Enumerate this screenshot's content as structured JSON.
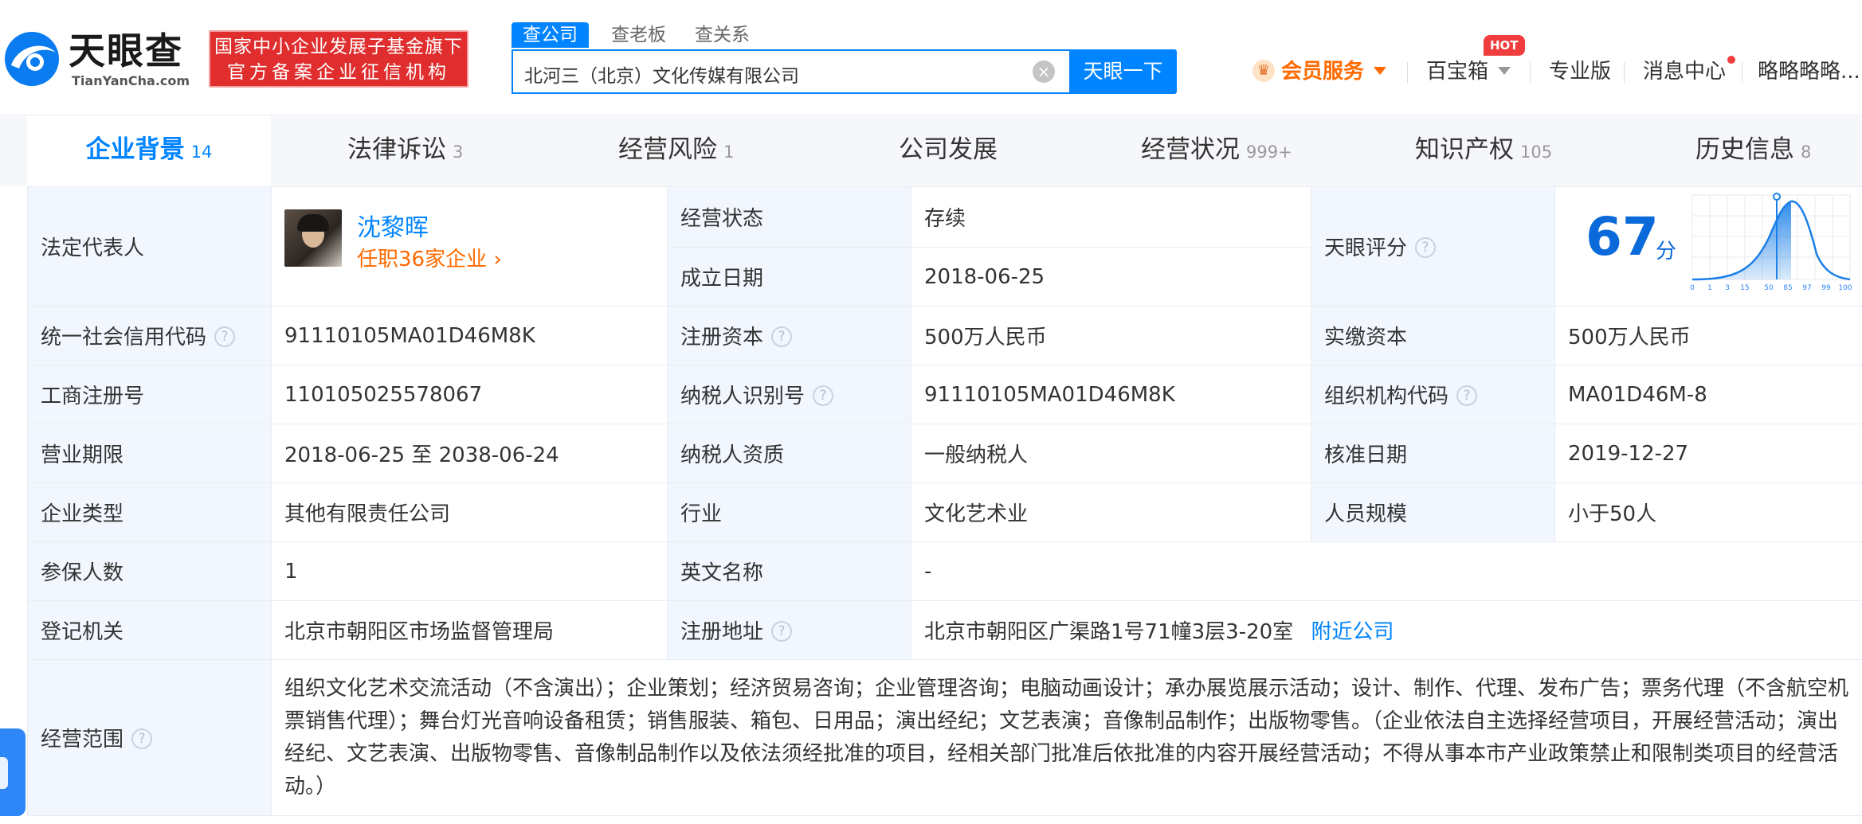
{
  "brand": {
    "name_cn": "天眼查",
    "name_en": "TianYanCha.com",
    "gov_line1": "国家中小企业发展子基金旗下",
    "gov_line2": "官方备案企业征信机构",
    "colors": {
      "accent": "#0084ff",
      "badge": "#e02d2d",
      "orange": "#ff6a00",
      "green": "#2aa34a"
    }
  },
  "search": {
    "tabs": [
      "查公司",
      "查老板",
      "查关系"
    ],
    "value": "北河三（北京）文化传媒有限公司",
    "button": "天眼一下"
  },
  "nav": {
    "vip": "会员服务",
    "baobox": "百宝箱",
    "hot": "HOT",
    "pro": "专业版",
    "messages": "消息中心",
    "user": "略略略略..."
  },
  "tabs": [
    {
      "label": "企业背景",
      "count": "14"
    },
    {
      "label": "法律诉讼",
      "count": "3"
    },
    {
      "label": "经营风险",
      "count": "1"
    },
    {
      "label": "公司发展",
      "count": ""
    },
    {
      "label": "经营状况",
      "count": "999+"
    },
    {
      "label": "知识产权",
      "count": "105"
    },
    {
      "label": "历史信息",
      "count": "8"
    }
  ],
  "info": {
    "legal_rep_label": "法定代表人",
    "legal_rep_name": "沈黎晖",
    "legal_rep_jobs": "任职36家企业",
    "status_label": "经营状态",
    "status_value": "存续",
    "founded_label": "成立日期",
    "founded_value": "2018-06-25",
    "score_label": "天眼评分",
    "score_value": "67",
    "score_unit": "分",
    "score_axis": [
      "0",
      "1",
      "3",
      "15",
      "50",
      "85",
      "97",
      "99",
      "100"
    ],
    "credit_code_label": "统一社会信用代码",
    "credit_code_value": "91110105MA01D46M8K",
    "reg_capital_label": "注册资本",
    "reg_capital_value": "500万人民币",
    "paid_capital_label": "实缴资本",
    "paid_capital_value": "500万人民币",
    "biz_reg_no_label": "工商注册号",
    "biz_reg_no_value": "110105025578067",
    "taxpayer_id_label": "纳税人识别号",
    "taxpayer_id_value": "91110105MA01D46M8K",
    "org_code_label": "组织机构代码",
    "org_code_value": "MA01D46M-8",
    "term_label": "营业期限",
    "term_value": "2018-06-25 至 2038-06-24",
    "tax_qual_label": "纳税人资质",
    "tax_qual_value": "一般纳税人",
    "approve_label": "核准日期",
    "approve_value": "2019-12-27",
    "type_label": "企业类型",
    "type_value": "其他有限责任公司",
    "industry_label": "行业",
    "industry_value": "文化艺术业",
    "staff_label": "人员规模",
    "staff_value": "小于50人",
    "insured_label": "参保人数",
    "insured_value": "1",
    "en_name_label": "英文名称",
    "en_name_value": "-",
    "authority_label": "登记机关",
    "authority_value": "北京市朝阳区市场监督管理局",
    "address_label": "注册地址",
    "address_value": "北京市朝阳区广渠路1号71幢3层3-20室",
    "nearby_link": "附近公司",
    "scope_label": "经营范围",
    "scope_value": "组织文化艺术交流活动（不含演出）；企业策划；经济贸易咨询；企业管理咨询；电脑动画设计；承办展览展示活动；设计、制作、代理、发布广告；票务代理（不含航空机票销售代理）；舞台灯光音响设备租赁；销售服装、箱包、日用品；演出经纪；文艺表演；音像制品制作；出版物零售。（企业依法自主选择经营项目，开展经营活动；演出经纪、文艺表演、出版物零售、音像制品制作以及依法须经批准的项目，经相关部门批准后依批准的内容开展经营活动；不得从事本市产业政策禁止和限制类项目的经营活动。）"
  }
}
